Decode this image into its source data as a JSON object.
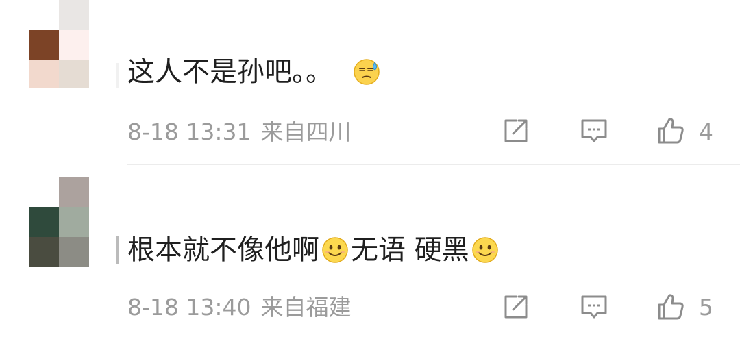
{
  "comments": [
    {
      "text_parts": [
        "这人不是孙吧。。",
        ""
      ],
      "emoji": [
        "sweat-emoji"
      ],
      "date": "8-18 13:31",
      "location": "来自四川",
      "likes": "4",
      "avatar_colors": [
        "#ffffff",
        "#e9e6e4",
        "#7c4326",
        "#fdf0ee",
        "#f2d9cd",
        "#e5dcd3"
      ]
    },
    {
      "text_parts": [
        "根本就不像他啊",
        "无语 硬黑",
        ""
      ],
      "emoji": [
        "smile-emoji",
        "smile-emoji"
      ],
      "date": "8-18 13:40",
      "location": "来自福建",
      "likes": "5",
      "avatar_colors": [
        "#ffffff",
        "#aca29e",
        "#2f4a3c",
        "#a0ab9f",
        "#4a4c40",
        "#8c8c85"
      ]
    }
  ],
  "colors": {
    "text": "#1f1f1f",
    "meta": "#9b9b9b",
    "divider": "#ececec"
  },
  "icons": [
    "share-icon",
    "reply-icon",
    "like-icon"
  ]
}
